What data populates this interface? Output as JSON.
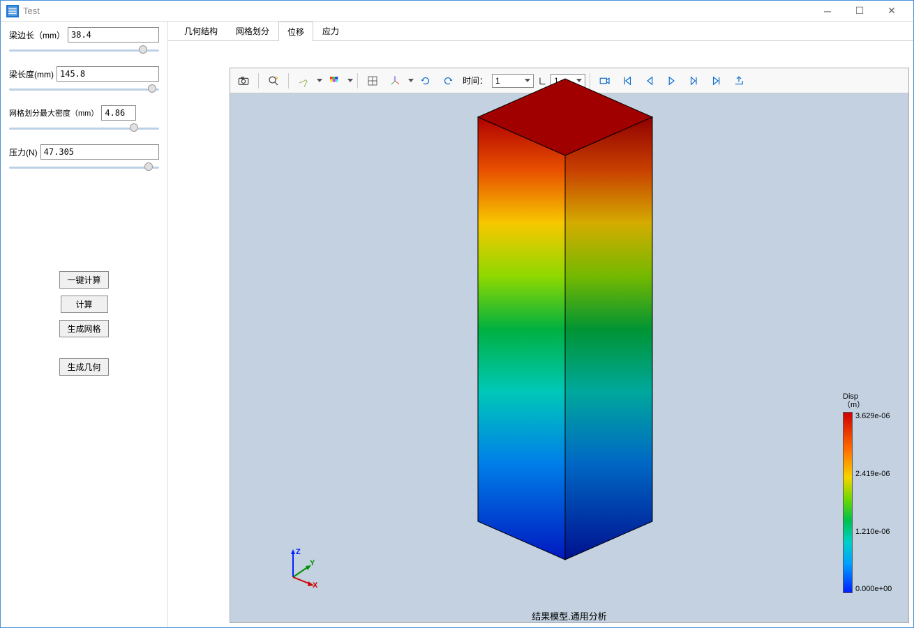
{
  "window": {
    "title": "Test"
  },
  "params": {
    "beam_edge": {
      "label": "梁边长（mm）",
      "value": "38.4",
      "slider_pct": 90
    },
    "beam_length": {
      "label": "梁长度(mm)",
      "value": "145.8",
      "slider_pct": 95
    },
    "mesh_density": {
      "label": "网格划分最大密度（mm）",
      "value": "4.86",
      "slider_pct": 84
    },
    "pressure": {
      "label": "压力(N)",
      "value": "47.305",
      "slider_pct": 94
    }
  },
  "buttons": {
    "one_click_calc": "一键计算",
    "calc": "计算",
    "gen_mesh": "生成网格",
    "gen_geometry": "生成几何"
  },
  "tabs": {
    "geometry": "几何结构",
    "mesh": "网格划分",
    "displacement": "位移",
    "stress": "应力",
    "active": "displacement"
  },
  "toolbar": {
    "time_label": "时间：",
    "time_a": "1",
    "time_b": "1"
  },
  "caption": "结果模型.通用分析",
  "legend": {
    "title1": "Disp",
    "title2": "（m）",
    "max": "3.629e-06",
    "mid2": "2.419e-06",
    "mid1": "1.210e-06",
    "min": "0.000e+00"
  }
}
